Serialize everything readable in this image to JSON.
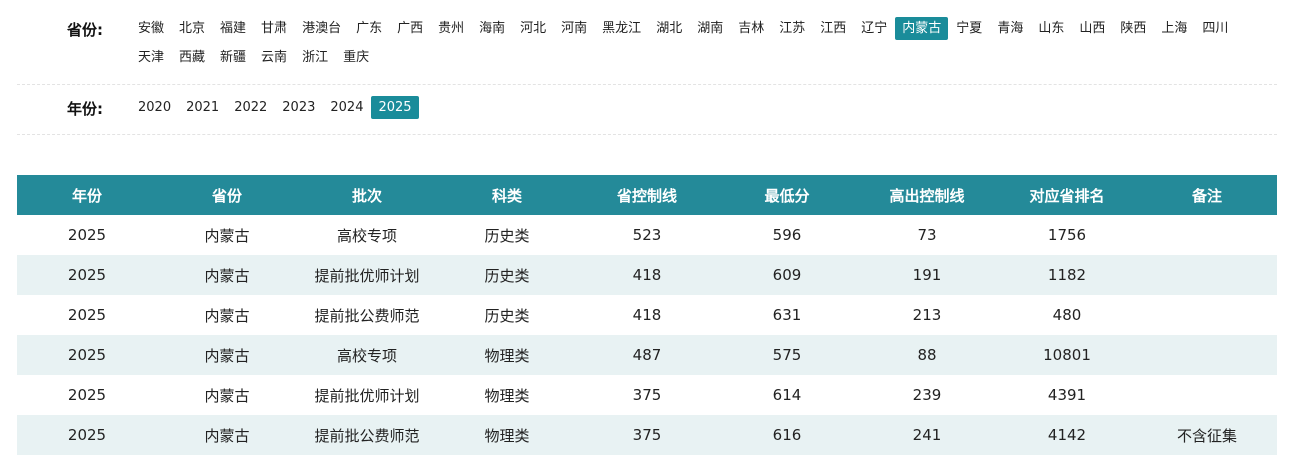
{
  "filters": {
    "province": {
      "label": "省份:",
      "selected": "内蒙古",
      "options": [
        "安徽",
        "北京",
        "福建",
        "甘肃",
        "港澳台",
        "广东",
        "广西",
        "贵州",
        "海南",
        "河北",
        "河南",
        "黑龙江",
        "湖北",
        "湖南",
        "吉林",
        "江苏",
        "江西",
        "辽宁",
        "内蒙古",
        "宁夏",
        "青海",
        "山东",
        "山西",
        "陕西",
        "上海",
        "四川",
        "天津",
        "西藏",
        "新疆",
        "云南",
        "浙江",
        "重庆"
      ]
    },
    "year": {
      "label": "年份:",
      "selected": "2025",
      "options": [
        "2020",
        "2021",
        "2022",
        "2023",
        "2024",
        "2025"
      ]
    }
  },
  "colors": {
    "accent": "#1a8c9a",
    "header_bg": "#248a99",
    "stripe_bg": "#e8f2f3"
  },
  "table": {
    "columns": [
      "年份",
      "省份",
      "批次",
      "科类",
      "省控制线",
      "最低分",
      "高出控制线",
      "对应省排名",
      "备注"
    ],
    "rows": [
      [
        "2025",
        "内蒙古",
        "高校专项",
        "历史类",
        "523",
        "596",
        "73",
        "1756",
        ""
      ],
      [
        "2025",
        "内蒙古",
        "提前批优师计划",
        "历史类",
        "418",
        "609",
        "191",
        "1182",
        ""
      ],
      [
        "2025",
        "内蒙古",
        "提前批公费师范",
        "历史类",
        "418",
        "631",
        "213",
        "480",
        ""
      ],
      [
        "2025",
        "内蒙古",
        "高校专项",
        "物理类",
        "487",
        "575",
        "88",
        "10801",
        ""
      ],
      [
        "2025",
        "内蒙古",
        "提前批优师计划",
        "物理类",
        "375",
        "614",
        "239",
        "4391",
        ""
      ],
      [
        "2025",
        "内蒙古",
        "提前批公费师范",
        "物理类",
        "375",
        "616",
        "241",
        "4142",
        "不含征集"
      ]
    ]
  }
}
